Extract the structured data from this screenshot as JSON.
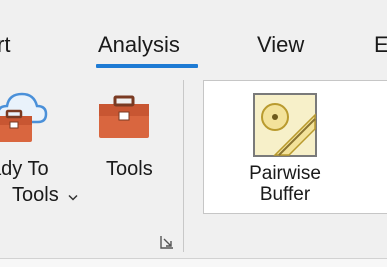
{
  "tabs": {
    "partial_left": "rt",
    "analysis": "Analysis",
    "view": "View",
    "partial_right": "E"
  },
  "group": {
    "ready_to_use": {
      "line1": "ady To",
      "line2": "Tools",
      "icon": "cloud-toolbox-icon",
      "dropdown_icon": "chevron-down-icon"
    },
    "tools": {
      "label": "Tools",
      "icon": "toolbox-icon"
    },
    "launcher_icon": "dialog-launcher-icon"
  },
  "gallery": {
    "pairwise_buffer": {
      "line1": "Pairwise",
      "line2": "Buffer",
      "icon": "pairwise-buffer-icon"
    }
  },
  "colors": {
    "accent": "#1e7bd4",
    "toolbox": "#d9663f",
    "cloud": "#4a90d9",
    "buffer_fill": "#f3e29a"
  }
}
